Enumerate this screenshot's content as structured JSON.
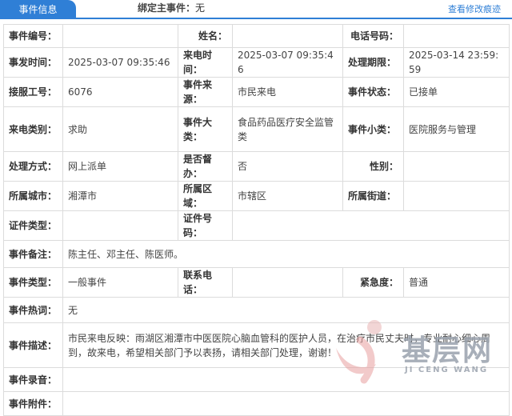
{
  "header": {
    "tab_label": "事件信息",
    "bind_main_label": "绑定主事件：",
    "bind_main_value": "无",
    "view_link": "查看修改痕迹"
  },
  "fields": {
    "event_no": {
      "label": "事件编号：",
      "value": ""
    },
    "name": {
      "label": "姓名：",
      "value": ""
    },
    "phone": {
      "label": "电话号码：",
      "value": ""
    },
    "occur_time": {
      "label": "事发时间：",
      "value": "2025-03-07 09:35:46"
    },
    "call_time": {
      "label": "来电时间：",
      "value": "2025-03-07 09:35:46"
    },
    "deadline": {
      "label": "处理期限：",
      "value": "2025-03-14 23:59:59"
    },
    "operator_no": {
      "label": "接服工号：",
      "value": "6076"
    },
    "source": {
      "label": "事件来源：",
      "value": "市民来电"
    },
    "status": {
      "label": "事件状态：",
      "value": "已接单"
    },
    "call_type": {
      "label": "来电类别：",
      "value": "求助"
    },
    "category": {
      "label": "事件大类：",
      "value": "食品药品医疗安全监管类"
    },
    "subcategory": {
      "label": "事件小类：",
      "value": "医院服务与管理"
    },
    "handling": {
      "label": "处理方式：",
      "value": "网上派单"
    },
    "supervise": {
      "label": "是否督办：",
      "value": "否"
    },
    "gender": {
      "label": "性别：",
      "value": ""
    },
    "city": {
      "label": "所属城市：",
      "value": "湘潭市"
    },
    "district": {
      "label": "所属区域：",
      "value": "市辖区"
    },
    "street": {
      "label": "所属街道：",
      "value": ""
    },
    "id_type": {
      "label": "证件类型：",
      "value": ""
    },
    "id_no": {
      "label": "证件号码：",
      "value": ""
    },
    "remark": {
      "label": "事件备注：",
      "value": "陈主任、邓主任、陈医师。"
    },
    "event_type": {
      "label": "事件类型：",
      "value": "一般事件"
    },
    "contact_phone": {
      "label": "联系电话：",
      "value": ""
    },
    "urgency": {
      "label": "紧急度：",
      "value": "普通"
    },
    "hotword": {
      "label": "事件热词：",
      "value": "无"
    },
    "description": {
      "label": "事件描述：",
      "value": "市民来电反映：雨湖区湘潭市中医医院心脑血管科的医护人员，在治疗市民丈夫时，专业耐心细心周到，故来电，希望相关部门予以表扬，请相关部门处理，谢谢！"
    },
    "recording": {
      "label": "事件录音：",
      "value": ""
    },
    "attachment": {
      "label": "事件附件：",
      "value": ""
    }
  },
  "watermark": {
    "text": "基层网",
    "sub": "JI CENG WANG"
  }
}
